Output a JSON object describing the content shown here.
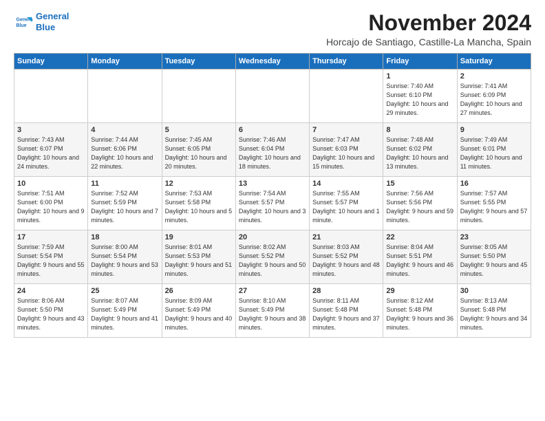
{
  "logo": {
    "line1": "General",
    "line2": "Blue"
  },
  "header": {
    "month": "November 2024",
    "location": "Horcajo de Santiago, Castille-La Mancha, Spain"
  },
  "weekdays": [
    "Sunday",
    "Monday",
    "Tuesday",
    "Wednesday",
    "Thursday",
    "Friday",
    "Saturday"
  ],
  "weeks": [
    [
      {
        "day": "",
        "info": ""
      },
      {
        "day": "",
        "info": ""
      },
      {
        "day": "",
        "info": ""
      },
      {
        "day": "",
        "info": ""
      },
      {
        "day": "",
        "info": ""
      },
      {
        "day": "1",
        "info": "Sunrise: 7:40 AM\nSunset: 6:10 PM\nDaylight: 10 hours and 29 minutes."
      },
      {
        "day": "2",
        "info": "Sunrise: 7:41 AM\nSunset: 6:09 PM\nDaylight: 10 hours and 27 minutes."
      }
    ],
    [
      {
        "day": "3",
        "info": "Sunrise: 7:43 AM\nSunset: 6:07 PM\nDaylight: 10 hours and 24 minutes."
      },
      {
        "day": "4",
        "info": "Sunrise: 7:44 AM\nSunset: 6:06 PM\nDaylight: 10 hours and 22 minutes."
      },
      {
        "day": "5",
        "info": "Sunrise: 7:45 AM\nSunset: 6:05 PM\nDaylight: 10 hours and 20 minutes."
      },
      {
        "day": "6",
        "info": "Sunrise: 7:46 AM\nSunset: 6:04 PM\nDaylight: 10 hours and 18 minutes."
      },
      {
        "day": "7",
        "info": "Sunrise: 7:47 AM\nSunset: 6:03 PM\nDaylight: 10 hours and 15 minutes."
      },
      {
        "day": "8",
        "info": "Sunrise: 7:48 AM\nSunset: 6:02 PM\nDaylight: 10 hours and 13 minutes."
      },
      {
        "day": "9",
        "info": "Sunrise: 7:49 AM\nSunset: 6:01 PM\nDaylight: 10 hours and 11 minutes."
      }
    ],
    [
      {
        "day": "10",
        "info": "Sunrise: 7:51 AM\nSunset: 6:00 PM\nDaylight: 10 hours and 9 minutes."
      },
      {
        "day": "11",
        "info": "Sunrise: 7:52 AM\nSunset: 5:59 PM\nDaylight: 10 hours and 7 minutes."
      },
      {
        "day": "12",
        "info": "Sunrise: 7:53 AM\nSunset: 5:58 PM\nDaylight: 10 hours and 5 minutes."
      },
      {
        "day": "13",
        "info": "Sunrise: 7:54 AM\nSunset: 5:57 PM\nDaylight: 10 hours and 3 minutes."
      },
      {
        "day": "14",
        "info": "Sunrise: 7:55 AM\nSunset: 5:57 PM\nDaylight: 10 hours and 1 minute."
      },
      {
        "day": "15",
        "info": "Sunrise: 7:56 AM\nSunset: 5:56 PM\nDaylight: 9 hours and 59 minutes."
      },
      {
        "day": "16",
        "info": "Sunrise: 7:57 AM\nSunset: 5:55 PM\nDaylight: 9 hours and 57 minutes."
      }
    ],
    [
      {
        "day": "17",
        "info": "Sunrise: 7:59 AM\nSunset: 5:54 PM\nDaylight: 9 hours and 55 minutes."
      },
      {
        "day": "18",
        "info": "Sunrise: 8:00 AM\nSunset: 5:54 PM\nDaylight: 9 hours and 53 minutes."
      },
      {
        "day": "19",
        "info": "Sunrise: 8:01 AM\nSunset: 5:53 PM\nDaylight: 9 hours and 51 minutes."
      },
      {
        "day": "20",
        "info": "Sunrise: 8:02 AM\nSunset: 5:52 PM\nDaylight: 9 hours and 50 minutes."
      },
      {
        "day": "21",
        "info": "Sunrise: 8:03 AM\nSunset: 5:52 PM\nDaylight: 9 hours and 48 minutes."
      },
      {
        "day": "22",
        "info": "Sunrise: 8:04 AM\nSunset: 5:51 PM\nDaylight: 9 hours and 46 minutes."
      },
      {
        "day": "23",
        "info": "Sunrise: 8:05 AM\nSunset: 5:50 PM\nDaylight: 9 hours and 45 minutes."
      }
    ],
    [
      {
        "day": "24",
        "info": "Sunrise: 8:06 AM\nSunset: 5:50 PM\nDaylight: 9 hours and 43 minutes."
      },
      {
        "day": "25",
        "info": "Sunrise: 8:07 AM\nSunset: 5:49 PM\nDaylight: 9 hours and 41 minutes."
      },
      {
        "day": "26",
        "info": "Sunrise: 8:09 AM\nSunset: 5:49 PM\nDaylight: 9 hours and 40 minutes."
      },
      {
        "day": "27",
        "info": "Sunrise: 8:10 AM\nSunset: 5:49 PM\nDaylight: 9 hours and 38 minutes."
      },
      {
        "day": "28",
        "info": "Sunrise: 8:11 AM\nSunset: 5:48 PM\nDaylight: 9 hours and 37 minutes."
      },
      {
        "day": "29",
        "info": "Sunrise: 8:12 AM\nSunset: 5:48 PM\nDaylight: 9 hours and 36 minutes."
      },
      {
        "day": "30",
        "info": "Sunrise: 8:13 AM\nSunset: 5:48 PM\nDaylight: 9 hours and 34 minutes."
      }
    ]
  ]
}
